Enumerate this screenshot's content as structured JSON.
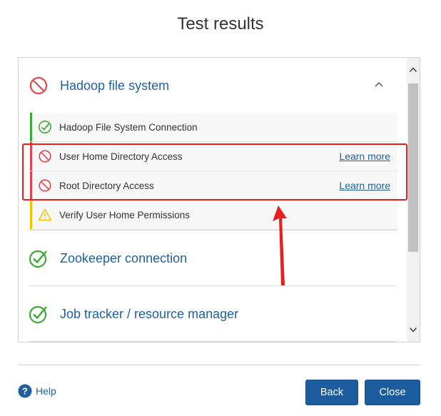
{
  "dialog": {
    "title": "Test results"
  },
  "sections": [
    {
      "label": "Hadoop file system",
      "status": "error",
      "expanded": true
    },
    {
      "label": "Zookeeper connection",
      "status": "success"
    },
    {
      "label": "Job tracker / resource manager",
      "status": "success"
    }
  ],
  "hadoop_checks": [
    {
      "label": "Hadoop File System Connection",
      "status": "success",
      "link": ""
    },
    {
      "label": "User Home Directory Access",
      "status": "error",
      "link": "Learn more"
    },
    {
      "label": "Root Directory Access",
      "status": "error",
      "link": "Learn more"
    },
    {
      "label": "Verify User Home Permissions",
      "status": "warning",
      "link": ""
    }
  ],
  "footer": {
    "help_label": "Help",
    "back_label": "Back",
    "close_label": "Close"
  },
  "colors": {
    "success": "#3aaa35",
    "error": "#e0474c",
    "warning": "#f2c400",
    "link": "#1f5f9e",
    "primary_button": "#1a5c9e",
    "annotation": "#e8201c"
  }
}
